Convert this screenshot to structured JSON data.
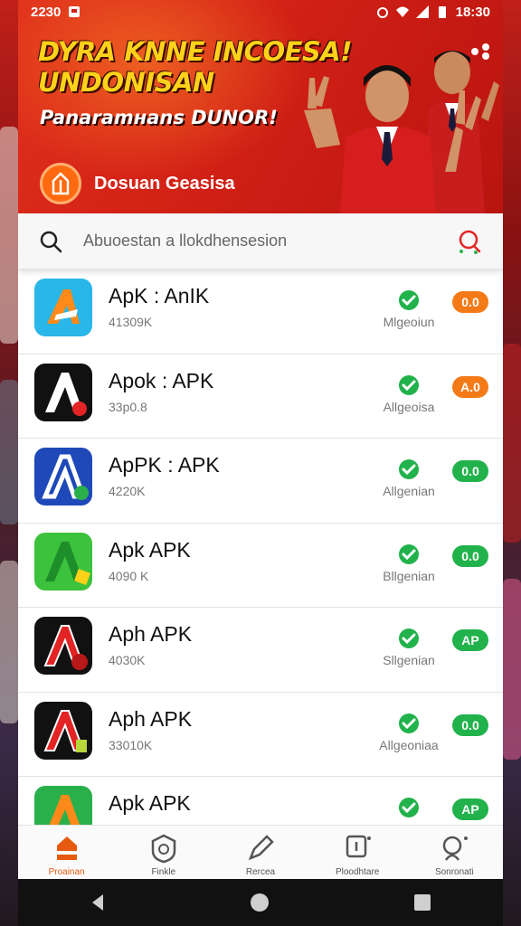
{
  "status_bar": {
    "left_time": "2230",
    "right_time": "18:30"
  },
  "banner": {
    "headline_line1": "DYRA KNNE INCOESA!",
    "headline_line2": "UNDONISAN",
    "subline": "Panaramнans DUNOR!",
    "brand_name": "Dosuan Geasisa"
  },
  "search": {
    "placeholder": "Abuoestan a llokdhensesion"
  },
  "apps": [
    {
      "name": "ApK : AnIK",
      "size": "41309K",
      "status": "Mlgeoiun",
      "badge": "0.0",
      "badge_color": "orange",
      "icon_colors": [
        "#29b6e8",
        "#ff8a1a"
      ]
    },
    {
      "name": "Apok : APK",
      "size": "33p0.8",
      "status": "Allgeoisa",
      "badge": "A.0",
      "badge_color": "orange",
      "icon_colors": [
        "#111111",
        "#ffffff"
      ]
    },
    {
      "name": "ApPK : APK",
      "size": "4220K",
      "status": "Allgenian",
      "badge": "0.0",
      "badge_color": "green",
      "icon_colors": [
        "#1f49b8",
        "#ffffff"
      ]
    },
    {
      "name": "Apk APK",
      "size": "4090 K",
      "status": "Bllgenian",
      "badge": "0.0",
      "badge_color": "green",
      "icon_colors": [
        "#3cc23c",
        "#1e8e2a"
      ]
    },
    {
      "name": "Aph APK",
      "size": "4030K",
      "status": "Sllgenian",
      "badge": "AP",
      "badge_color": "green",
      "icon_colors": [
        "#111111",
        "#e22424"
      ]
    },
    {
      "name": "Aph APK",
      "size": "33010K",
      "status": "Allgeoniaa",
      "badge": "0.0",
      "badge_color": "green",
      "icon_colors": [
        "#111111",
        "#e22424"
      ]
    },
    {
      "name": "Apk APK",
      "size": "",
      "status": "",
      "badge": "AP",
      "badge_color": "green",
      "icon_colors": [
        "#2ab04a",
        "#ff8a1a"
      ]
    }
  ],
  "bottom_nav": [
    {
      "label": "Proainan",
      "icon": "home-icon",
      "active": true
    },
    {
      "label": "Finkle",
      "icon": "shield-icon",
      "active": false
    },
    {
      "label": "Rercea",
      "icon": "pen-icon",
      "active": false
    },
    {
      "label": "Ploodhtare",
      "icon": "download-icon",
      "active": false
    },
    {
      "label": "Sonronati",
      "icon": "search-person-icon",
      "active": false
    }
  ],
  "colors": {
    "accent": "#e65a10",
    "banner_red": "#d22116",
    "headline_yellow": "#ffd21a",
    "badge_orange": "#f47a18",
    "badge_green": "#22b24c"
  }
}
